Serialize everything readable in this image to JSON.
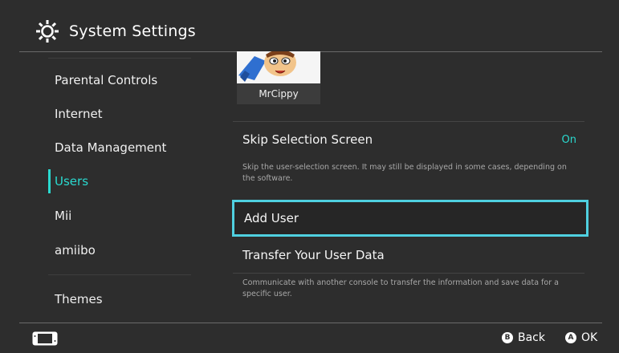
{
  "header": {
    "title": "System Settings",
    "icon": "gear-icon"
  },
  "sidebar": {
    "items": [
      {
        "label": "Parental Controls"
      },
      {
        "label": "Internet"
      },
      {
        "label": "Data Management"
      },
      {
        "label": "Users",
        "active": true
      },
      {
        "label": "Mii"
      },
      {
        "label": "amiibo"
      },
      {
        "label": "Themes"
      }
    ]
  },
  "user": {
    "name": "MrCippy"
  },
  "settings": {
    "skip_selection": {
      "label": "Skip Selection Screen",
      "value": "On",
      "description": "Skip the user-selection screen. It may still be displayed in some cases, depending on the software."
    },
    "add_user": {
      "label": "Add User"
    },
    "transfer": {
      "label": "Transfer Your User Data",
      "description": "Communicate with another console to transfer the information and save data for a specific user."
    }
  },
  "footer": {
    "back": {
      "button": "B",
      "label": "Back"
    },
    "ok": {
      "button": "A",
      "label": "OK"
    }
  },
  "colors": {
    "accent": "#2ad9cf",
    "focus": "#4fd0e0",
    "background": "#2d2d2d"
  }
}
